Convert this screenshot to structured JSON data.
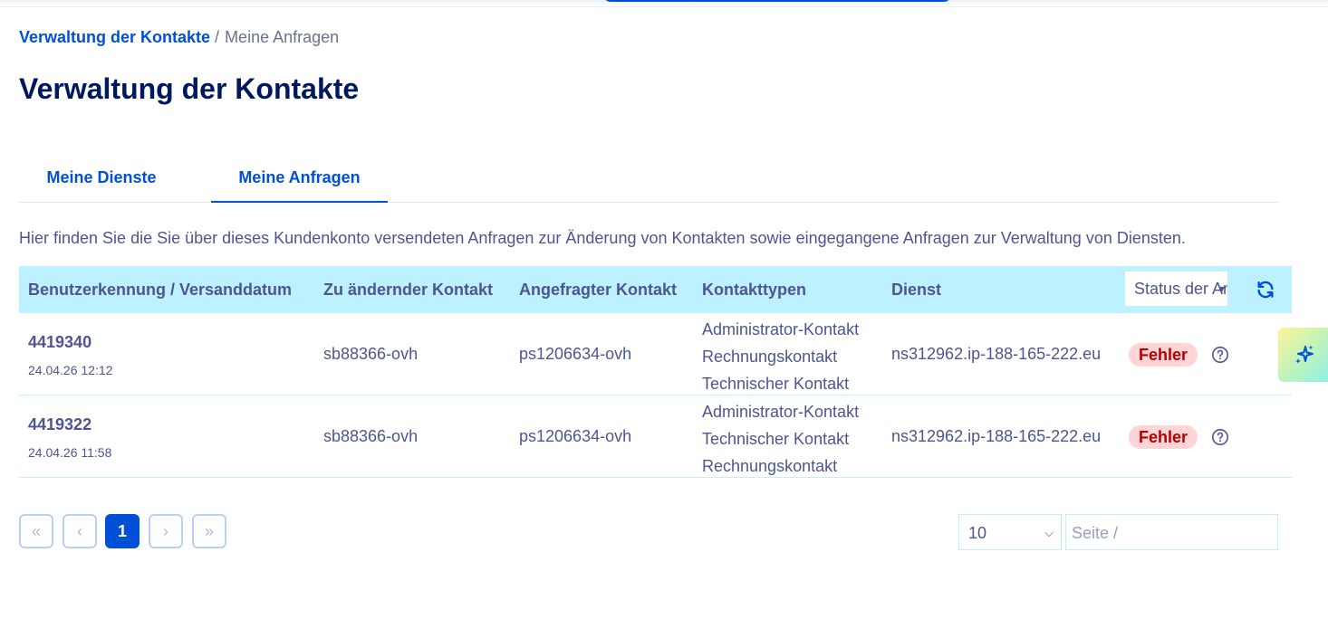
{
  "breadcrumb": {
    "root": "Verwaltung der Kontakte",
    "separator": "/",
    "current": "Meine Anfragen"
  },
  "page_title": "Verwaltung der Kontakte",
  "tabs": [
    {
      "label": "Meine Dienste",
      "active": false
    },
    {
      "label": "Meine Anfragen",
      "active": true
    }
  ],
  "intro": "Hier finden Sie die Sie über dieses Kundenkonto versendeten Anfragen zur Änderung von Kontakten sowie eingegangene Anfragen zur Verwaltung von Diensten.",
  "table": {
    "headers": {
      "id_date": "Benutzerkennung / Versanddatum",
      "from_contact": "Zu ändernder Kontakt",
      "to_contact": "Angefragter Kontakt",
      "types": "Kontakttypen",
      "service": "Dienst",
      "status_filter": "Status der Anfrage"
    },
    "rows": [
      {
        "id": "4419340",
        "date": "24.04.26 12:12",
        "from_contact": "sb88366-ovh",
        "to_contact": "ps1206634-ovh",
        "types": [
          "Administrator-Kontakt",
          "Rechnungskontakt",
          "Technischer Kontakt"
        ],
        "service": "ns312962.ip-188-165-222.eu",
        "status": "Fehler"
      },
      {
        "id": "4419322",
        "date": "24.04.26 11:58",
        "from_contact": "sb88366-ovh",
        "to_contact": "ps1206634-ovh",
        "types": [
          "Administrator-Kontakt",
          "Technischer Kontakt",
          "Rechnungskontakt"
        ],
        "service": "ns312962.ip-188-165-222.eu",
        "status": "Fehler"
      }
    ]
  },
  "pagination": {
    "first": "«",
    "prev": "‹",
    "current": "1",
    "next": "›",
    "last": "»",
    "page_size": "10",
    "page_placeholder": "Seite  /"
  },
  "icons": {
    "refresh": "refresh-icon",
    "help": "help-circle-icon",
    "ai": "sparkle-icon",
    "chevron": "chevron-down-icon"
  },
  "colors": {
    "primary": "#0050d7",
    "title": "#00185e",
    "text": "#4d5592",
    "header_bg": "#bef1ff",
    "error_bg": "#ffd4d6",
    "error_text": "#b30000"
  }
}
